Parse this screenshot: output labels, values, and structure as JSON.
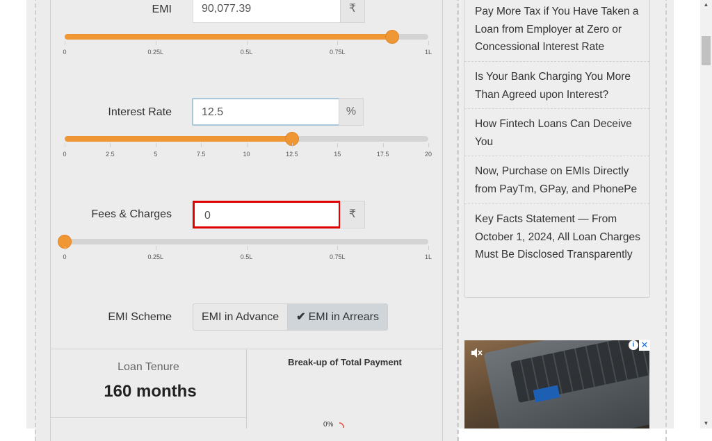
{
  "calculator": {
    "emi": {
      "label": "EMI",
      "value": "90,077.39",
      "addon": "₹",
      "level": 0.9,
      "ticks": [
        "0",
        "0.25L",
        "0.5L",
        "0.75L",
        "1L"
      ]
    },
    "interest": {
      "label": "Interest Rate",
      "value": "12.5",
      "addon": "%",
      "level": 0.625,
      "ticks": [
        "0",
        "2.5",
        "5",
        "7.5",
        "10",
        "12.5",
        "15",
        "17.5",
        "20"
      ]
    },
    "fees": {
      "label": "Fees & Charges",
      "value": "0",
      "addon": "₹",
      "level": 0.0,
      "ticks": [
        "0",
        "0.25L",
        "0.5L",
        "0.75L",
        "1L"
      ]
    },
    "scheme": {
      "label": "EMI Scheme",
      "options": [
        "EMI in Advance",
        "EMI in Arrears"
      ],
      "selected": "EMI in Arrears"
    }
  },
  "results": {
    "tenure_label": "Loan Tenure",
    "tenure_value": "160 months",
    "breakup_title": "Break-up of Total Payment",
    "breakup_pct": "0%"
  },
  "sidebar": {
    "articles": [
      "Pay More Tax if You Have Taken a Loan from Employer at Zero or Concessional Interest Rate",
      "Is Your Bank Charging You More Than Agreed upon Interest?",
      "How Fintech Loans Can Deceive You",
      "Now, Purchase on EMIs Directly from PayTm, GPay, and PhonePe",
      "Key Facts Statement — From October 1, 2024, All Loan Charges Must Be Disclosed Transparently"
    ]
  },
  "ad": {
    "info_icon": "info-icon",
    "close_icon": "close-icon",
    "mute_icon": "mute-icon"
  },
  "colors": {
    "slider_fill": "#ef9735",
    "highlight_border": "#e00000",
    "focus_border": "#a9c7da"
  }
}
